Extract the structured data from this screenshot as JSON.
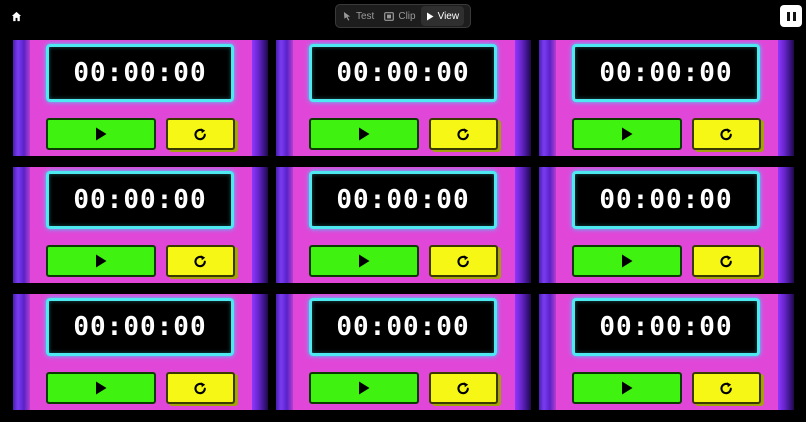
{
  "toolbar": {
    "home_icon": "home-icon",
    "modes": [
      {
        "label": "Test",
        "icon": "cursor-icon"
      },
      {
        "label": "Clip",
        "icon": "clip-icon"
      },
      {
        "label": "View",
        "icon": "play-icon",
        "active": true
      }
    ],
    "pause_icon": "pause-icon"
  },
  "timers": [
    {
      "time": "00:00:00"
    },
    {
      "time": "00:00:00"
    },
    {
      "time": "00:00:00"
    },
    {
      "time": "00:00:00"
    },
    {
      "time": "00:00:00"
    },
    {
      "time": "00:00:00"
    },
    {
      "time": "00:00:00"
    },
    {
      "time": "00:00:00"
    },
    {
      "time": "00:00:00"
    }
  ],
  "colors": {
    "panel": "#e047d8",
    "display_border": "#4de8f0",
    "play_button": "#3ff20f",
    "reset_button": "#f6f714"
  }
}
